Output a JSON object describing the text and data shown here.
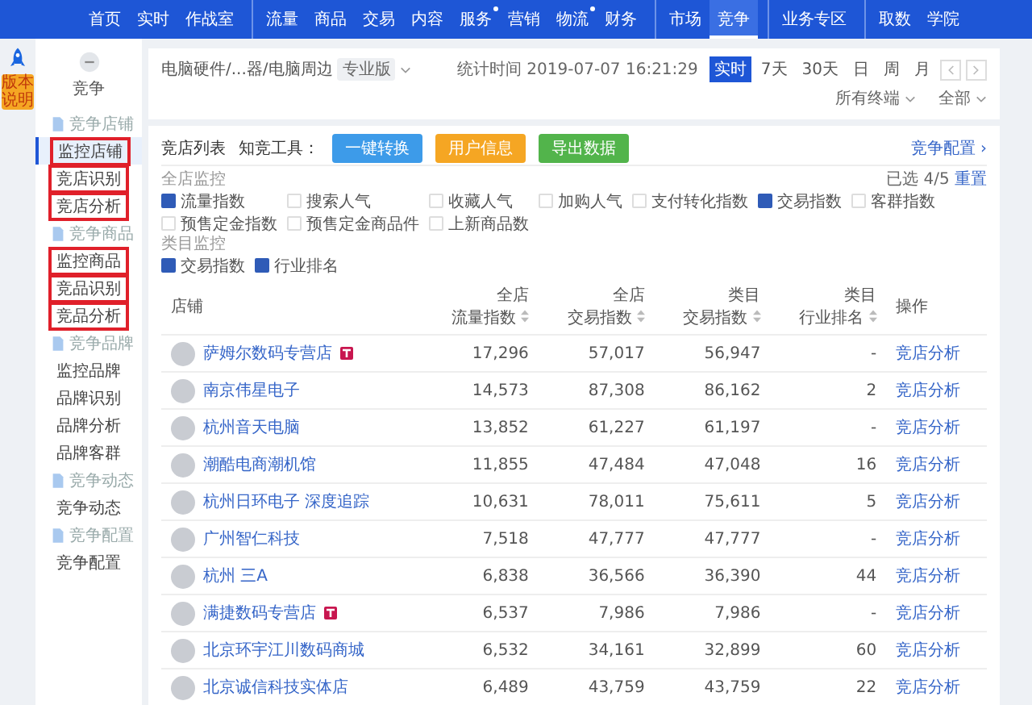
{
  "side_strip": {
    "badge": "版本说明"
  },
  "top_nav": [
    {
      "label": "首页",
      "selected": false,
      "dot": false,
      "gap_before": false
    },
    {
      "label": "实时",
      "selected": false,
      "dot": false,
      "gap_before": false
    },
    {
      "label": "作战室",
      "selected": false,
      "dot": false,
      "gap_before": false
    },
    {
      "label": "流量",
      "selected": false,
      "dot": false,
      "gap_before": true
    },
    {
      "label": "商品",
      "selected": false,
      "dot": false,
      "gap_before": false
    },
    {
      "label": "交易",
      "selected": false,
      "dot": false,
      "gap_before": false
    },
    {
      "label": "内容",
      "selected": false,
      "dot": false,
      "gap_before": false
    },
    {
      "label": "服务",
      "selected": false,
      "dot": true,
      "gap_before": false
    },
    {
      "label": "营销",
      "selected": false,
      "dot": false,
      "gap_before": false
    },
    {
      "label": "物流",
      "selected": false,
      "dot": true,
      "gap_before": false
    },
    {
      "label": "财务",
      "selected": false,
      "dot": false,
      "gap_before": false
    },
    {
      "label": "市场",
      "selected": false,
      "dot": false,
      "gap_before": true
    },
    {
      "label": "竞争",
      "selected": true,
      "dot": false,
      "gap_before": false
    },
    {
      "label": "业务专区",
      "selected": false,
      "dot": false,
      "gap_before": true
    },
    {
      "label": "取数",
      "selected": false,
      "dot": false,
      "gap_before": true
    },
    {
      "label": "学院",
      "selected": false,
      "dot": false,
      "gap_before": false
    }
  ],
  "sidebar": {
    "title": "竞争",
    "sections": [
      {
        "label": "竞争店铺",
        "items": [
          {
            "label": "监控店铺",
            "selected": true,
            "highlighted": true
          },
          {
            "label": "竞店识别",
            "selected": false,
            "highlighted": true
          },
          {
            "label": "竞店分析",
            "selected": false,
            "highlighted": true
          }
        ]
      },
      {
        "label": "竞争商品",
        "items": [
          {
            "label": "监控商品",
            "selected": false,
            "highlighted": true
          },
          {
            "label": "竞品识别",
            "selected": false,
            "highlighted": true
          },
          {
            "label": "竞品分析",
            "selected": false,
            "highlighted": true
          }
        ]
      },
      {
        "label": "竞争品牌",
        "items": [
          {
            "label": "监控品牌",
            "selected": false,
            "highlighted": false
          },
          {
            "label": "品牌识别",
            "selected": false,
            "highlighted": false
          },
          {
            "label": "品牌分析",
            "selected": false,
            "highlighted": false
          },
          {
            "label": "品牌客群",
            "selected": false,
            "highlighted": false
          }
        ]
      },
      {
        "label": "竞争动态",
        "items": [
          {
            "label": "竞争动态",
            "selected": false,
            "highlighted": false
          }
        ]
      },
      {
        "label": "竞争配置",
        "items": [
          {
            "label": "竞争配置",
            "selected": false,
            "highlighted": false
          }
        ]
      }
    ]
  },
  "header": {
    "category": "电脑硬件/...器/电脑周边",
    "edition": "专业版",
    "stat_time": "统计时间 2019-07-07 16:21:29",
    "periods": [
      {
        "label": "实时",
        "selected": true
      },
      {
        "label": "7天",
        "selected": false
      },
      {
        "label": "30天",
        "selected": false
      },
      {
        "label": "日",
        "selected": false
      },
      {
        "label": "周",
        "selected": false
      },
      {
        "label": "月",
        "selected": false
      }
    ],
    "filters": [
      "所有终端",
      "全部"
    ]
  },
  "shop_list": {
    "title": "竞店列表",
    "tools_label": "知竞工具：",
    "tools": [
      {
        "label": "一键转换",
        "color": "#3d9be9"
      },
      {
        "label": "用户信息",
        "color": "#f5a623"
      },
      {
        "label": "导出数据",
        "color": "#52b44b"
      }
    ],
    "config_link": "竞争配置 ›",
    "shop_monitor": {
      "label": "全店监控",
      "selected_count": "已选 4/5",
      "reset": "重置",
      "options": [
        {
          "label": "流量指数",
          "checked": true
        },
        {
          "label": "搜索人气",
          "checked": false
        },
        {
          "label": "收藏人气",
          "checked": false
        },
        {
          "label": "加购人气",
          "checked": false
        },
        {
          "label": "支付转化指数",
          "checked": false
        },
        {
          "label": "交易指数",
          "checked": true
        },
        {
          "label": "客群指数",
          "checked": false
        },
        {
          "label": "预售定金指数",
          "checked": false
        },
        {
          "label": "预售定金商品件",
          "checked": false
        },
        {
          "label": "上新商品数",
          "checked": false
        }
      ]
    },
    "category_monitor": {
      "label": "类目监控",
      "options": [
        {
          "label": "交易指数",
          "checked": true
        },
        {
          "label": "行业排名",
          "checked": true
        }
      ]
    },
    "table": {
      "columns": [
        {
          "label": "店铺",
          "sortable": false
        },
        {
          "top": "全店",
          "label": "流量指数",
          "sortable": true
        },
        {
          "top": "全店",
          "label": "交易指数",
          "sortable": true
        },
        {
          "top": "类目",
          "label": "交易指数",
          "sortable": true
        },
        {
          "top": "类目",
          "label": "行业排名",
          "sortable": true
        },
        {
          "label": "操作",
          "sortable": false
        }
      ],
      "rows": [
        {
          "tmall": true,
          "cells": [
            "萨姆尔数码专营店",
            "17,296",
            "57,017",
            "56,947",
            "-",
            "竞店分析"
          ]
        },
        {
          "tmall": false,
          "cells": [
            "南京伟星电子",
            "14,573",
            "87,308",
            "86,162",
            "2",
            "竞店分析"
          ]
        },
        {
          "tmall": false,
          "cells": [
            "杭州音天电脑",
            "13,852",
            "61,227",
            "61,197",
            "-",
            "竞店分析"
          ]
        },
        {
          "tmall": false,
          "cells": [
            "潮酷电商潮机馆",
            "11,855",
            "47,484",
            "47,048",
            "16",
            "竞店分析"
          ]
        },
        {
          "tmall": false,
          "cells": [
            "杭州日环电子 深度追踪",
            "10,631",
            "78,011",
            "75,611",
            "5",
            "竞店分析"
          ]
        },
        {
          "tmall": false,
          "cells": [
            "广州智仁科技",
            "7,518",
            "47,777",
            "47,777",
            "-",
            "竞店分析"
          ]
        },
        {
          "tmall": false,
          "cells": [
            "杭州 三A",
            "6,838",
            "36,566",
            "36,390",
            "44",
            "竞店分析"
          ]
        },
        {
          "tmall": true,
          "cells": [
            "满捷数码专营店",
            "6,537",
            "7,986",
            "7,986",
            "-",
            "竞店分析"
          ]
        },
        {
          "tmall": false,
          "cells": [
            "北京环宇江川数码商城",
            "6,532",
            "34,161",
            "32,899",
            "60",
            "竞店分析"
          ]
        },
        {
          "tmall": false,
          "cells": [
            "北京诚信科技实体店",
            "6,489",
            "43,759",
            "43,759",
            "22",
            "竞店分析"
          ]
        }
      ]
    }
  }
}
